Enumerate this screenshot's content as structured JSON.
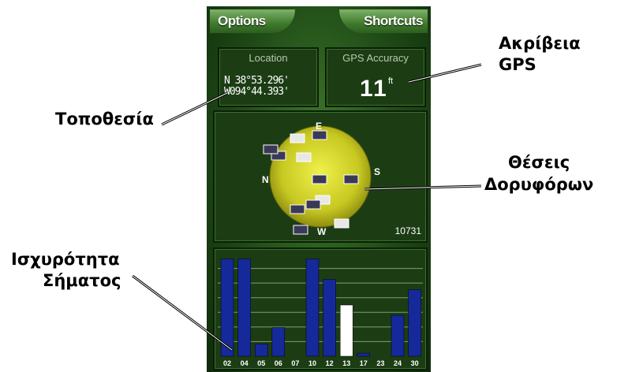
{
  "softkeys": {
    "left": "Options",
    "right": "Shortcuts"
  },
  "location": {
    "title": "Location",
    "lat": "N  38°53.296'",
    "lon": "W094°44.393'"
  },
  "accuracy": {
    "title": "GPS Accuracy",
    "value": "11",
    "unit": "ft"
  },
  "sky": {
    "compass": {
      "north": "N",
      "east": "E",
      "south": "S",
      "west": "W"
    },
    "time": "10731"
  },
  "satellites": {
    "ids": [
      "02",
      "04",
      "05",
      "06",
      "07",
      "10",
      "12",
      "13",
      "17",
      "23",
      "24",
      "30"
    ],
    "strength": [
      0.95,
      0.95,
      0.12,
      0.28,
      0.0,
      0.95,
      0.75,
      0.5,
      0.03,
      0.0,
      0.4,
      0.65
    ],
    "status": [
      "locked",
      "locked",
      "locked",
      "locked",
      "none",
      "locked",
      "locked",
      "searching",
      "locked",
      "none",
      "locked",
      "locked"
    ]
  },
  "callouts": {
    "location": "Τοποθεσία",
    "gps_accuracy": [
      "Ακρίβεια",
      "GPS"
    ],
    "satellite_positions": [
      "Θέσεις",
      "Δορυφόρων"
    ],
    "signal_strength": [
      "Ισχυρότητα",
      "Σήματος"
    ]
  },
  "colors": {
    "locked": "#16299a",
    "searching": "#ffffff",
    "sky_disc": "#d6d62a"
  }
}
